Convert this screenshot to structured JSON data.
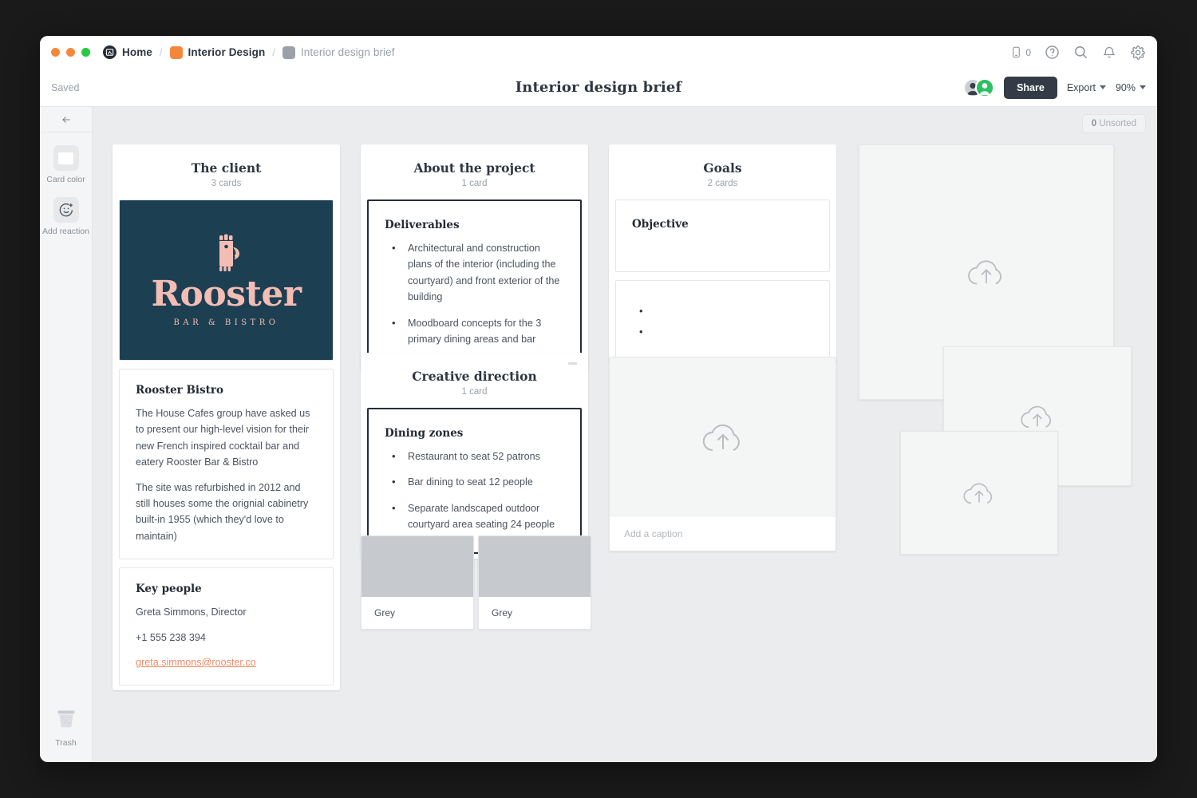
{
  "window": {
    "traffic_lights": [
      "close",
      "minimize",
      "zoom"
    ]
  },
  "breadcrumb": {
    "home": "Home",
    "project": "Interior Design",
    "document": "Interior design brief",
    "separator": "/"
  },
  "toolbar": {
    "device_count": "0",
    "help_icon": "question-circle-icon",
    "search_icon": "search-icon",
    "notifications_icon": "bell-icon",
    "settings_icon": "gear-icon"
  },
  "actionbar": {
    "saved_status": "Saved",
    "title": "Interior design brief",
    "share_label": "Share",
    "export_label": "Export",
    "zoom_label": "90%"
  },
  "rail": {
    "back_icon": "arrow-left-icon",
    "tools": [
      {
        "label": "Card color",
        "icon": "card-color-icon"
      },
      {
        "label": "Add reaction",
        "icon": "smiley-plus-icon"
      }
    ],
    "trash_label": "Trash"
  },
  "canvas": {
    "unsorted_count": "0",
    "unsorted_label": "Unsorted",
    "caption_placeholder": "Add a caption"
  },
  "columns": [
    {
      "title": "The client",
      "count": "3 cards",
      "logo": {
        "brand": "Rooster",
        "tagline": "BAR & BISTRO",
        "bg_color": "#1D3F52",
        "fg_color": "#F3BDB4"
      },
      "cards": [
        {
          "title": "Rooster Bistro",
          "paragraphs": [
            "The House Cafes group have asked us to present our high-level vision for their new French inspired cocktail bar and eatery Rooster Bar & Bistro",
            "The site was refurbished in 2012 and still houses some the orignial cabinetry built-in 1955 (which they'd love to maintain)"
          ]
        },
        {
          "title": "Key people",
          "paragraphs": [
            "Greta Simmons, Director",
            "+1 555 238 394"
          ],
          "link": "greta.simmons@rooster.co"
        }
      ]
    },
    {
      "title": "About the project",
      "count": "1 card",
      "cards": [
        {
          "title": "Deliverables",
          "selected": true,
          "bullets": [
            "Architectural and construction plans of the interior (including the courtyard) and front exterior of the building",
            "Moodboard concepts for the 3 primary dining areas and bar"
          ]
        }
      ]
    },
    {
      "title": "Creative direction",
      "count": "1 card",
      "cards": [
        {
          "title": "Dining zones",
          "selected": true,
          "bullets": [
            "Restaurant to seat 52 patrons",
            "Bar dining to seat 12 people",
            "Separate landscaped outdoor courtyard area seating 24 people"
          ]
        }
      ]
    },
    {
      "title": "Goals",
      "count": "2 cards",
      "cards": [
        {
          "title": "Objective",
          "bullets": []
        },
        {
          "title": "",
          "bullets": [
            "",
            ""
          ]
        }
      ]
    }
  ],
  "swatches": [
    {
      "label": "Grey",
      "color": "#C6C9CE"
    },
    {
      "label": "Grey",
      "color": "#C6C9CE"
    }
  ],
  "upload_placeholders": [
    {
      "name": "upload-card-goals",
      "icon": "cloud-upload-icon",
      "has_caption": true
    },
    {
      "name": "upload-card-large",
      "icon": "cloud-upload-icon",
      "has_caption": false
    },
    {
      "name": "upload-card-mid",
      "icon": "cloud-upload-icon",
      "has_caption": false
    },
    {
      "name": "upload-card-small",
      "icon": "cloud-upload-icon",
      "has_caption": false
    }
  ],
  "colors": {
    "accent_orange": "#F5873D",
    "link_coral": "#F08A62",
    "dark_slate": "#2E3641",
    "canvas_bg": "#EBECEE",
    "brand_teal": "#1D3F52",
    "brand_pink": "#F3BDB4"
  }
}
